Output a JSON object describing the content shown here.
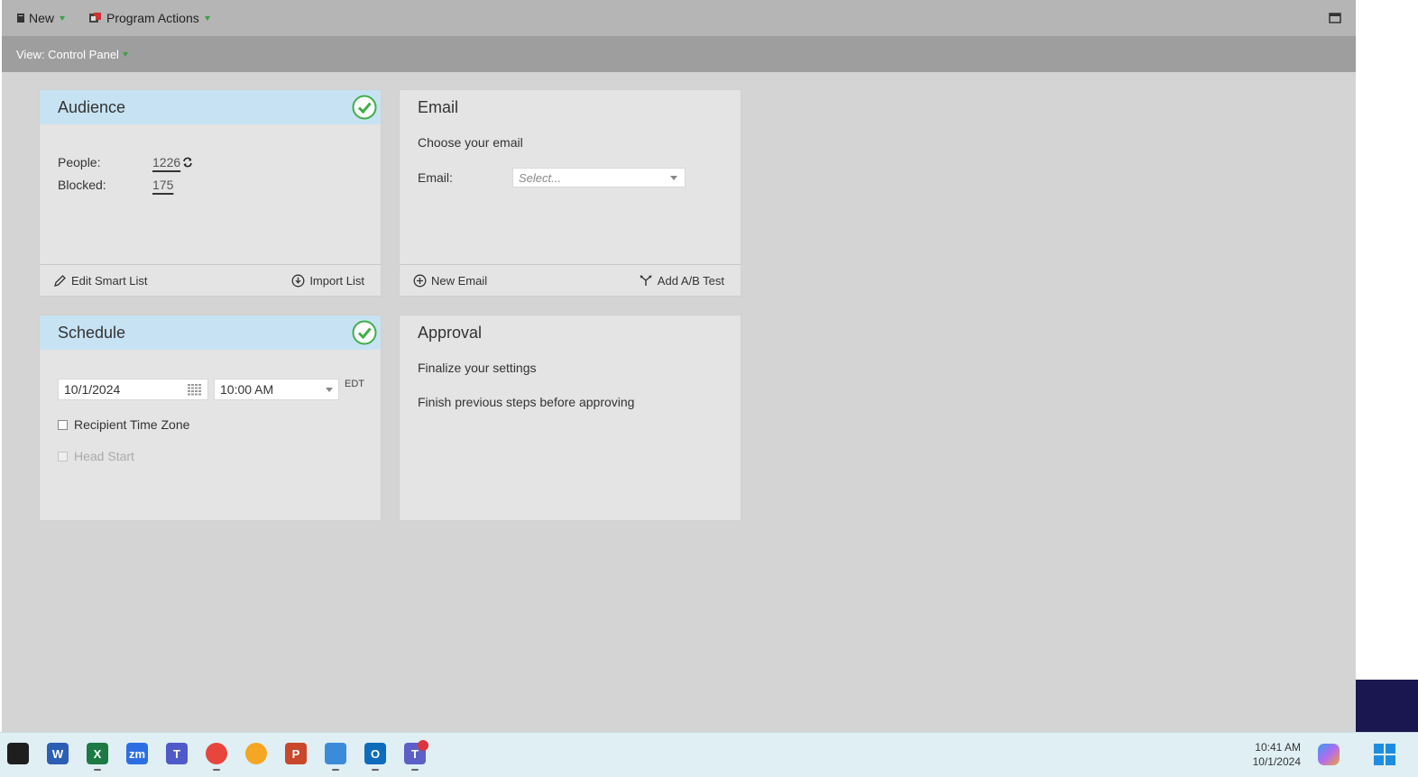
{
  "toolbar": {
    "new_label": "New",
    "program_actions_label": "Program Actions"
  },
  "viewbar": {
    "label": "View: Control Panel"
  },
  "audience": {
    "title": "Audience",
    "people_label": "People:",
    "people_value": "1226",
    "blocked_label": "Blocked:",
    "blocked_value": "175",
    "edit_smart_list": "Edit Smart List",
    "import_list": "Import List",
    "complete": true
  },
  "email": {
    "title": "Email",
    "subtitle": "Choose your email",
    "email_label": "Email:",
    "select_placeholder": "Select...",
    "new_email": "New Email",
    "add_ab_test": "Add A/B Test"
  },
  "schedule": {
    "title": "Schedule",
    "date": "10/1/2024",
    "time": "10:00 AM",
    "timezone": "EDT",
    "recipient_tz_label": "Recipient Time Zone",
    "head_start_label": "Head Start",
    "complete": true
  },
  "approval": {
    "title": "Approval",
    "line1": "Finalize your settings",
    "line2": "Finish previous steps before approving"
  },
  "taskbar": {
    "time": "10:41 AM",
    "date": "10/1/2024",
    "apps": [
      {
        "name": "acrobat",
        "glyph": "",
        "color": "#1e1e1e"
      },
      {
        "name": "word",
        "glyph": "W",
        "color": "#2b5fb3"
      },
      {
        "name": "excel",
        "glyph": "X",
        "color": "#1d7a45"
      },
      {
        "name": "zoom",
        "glyph": "zm",
        "color": "#2d6fe3"
      },
      {
        "name": "teams",
        "glyph": "T",
        "color": "#5059c9"
      },
      {
        "name": "chrome",
        "glyph": "",
        "color": "#e8453c"
      },
      {
        "name": "edge-canary",
        "glyph": "",
        "color": "#f5a623"
      },
      {
        "name": "powerpoint",
        "glyph": "P",
        "color": "#c9472b"
      },
      {
        "name": "snipping-tool",
        "glyph": "",
        "color": "#3c8bd9"
      },
      {
        "name": "outlook",
        "glyph": "O",
        "color": "#0f6cbd"
      },
      {
        "name": "teams-notify",
        "glyph": "T",
        "color": "#5b5fc7"
      }
    ]
  }
}
